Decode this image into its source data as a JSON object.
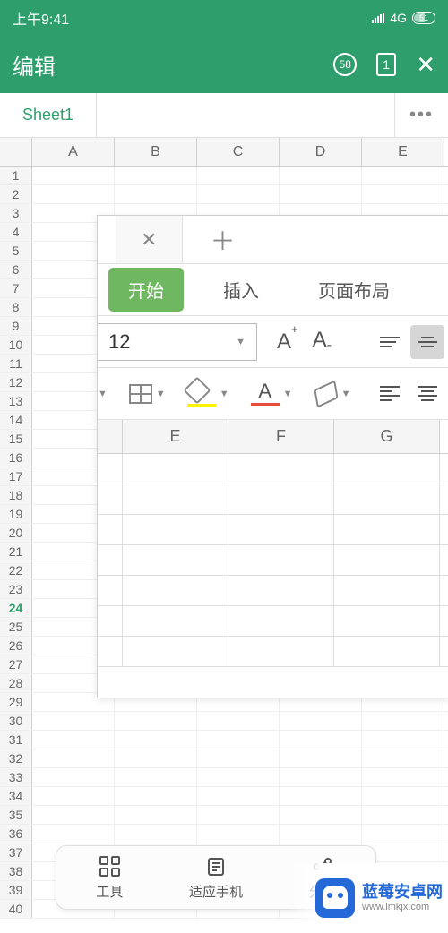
{
  "status": {
    "time": "上午9:41",
    "network": "4G",
    "battery": "51"
  },
  "header": {
    "title": "编辑",
    "badge": "58",
    "doc_count": "1"
  },
  "tabs": {
    "sheet": "Sheet1",
    "more": "•••"
  },
  "columns": [
    "A",
    "B",
    "C",
    "D",
    "E"
  ],
  "row_count": 40,
  "active_row": 24,
  "overlay": {
    "ribbon": {
      "start": "开始",
      "insert": "插入",
      "layout": "页面布局"
    },
    "font_size": "12",
    "columns": [
      "E",
      "F",
      "G"
    ]
  },
  "bottom_bar": {
    "tools": "工具",
    "adapt": "适应手机",
    "share": "分享"
  },
  "watermark": {
    "name": "蓝莓安卓网",
    "url": "www.lmkjx.com"
  }
}
